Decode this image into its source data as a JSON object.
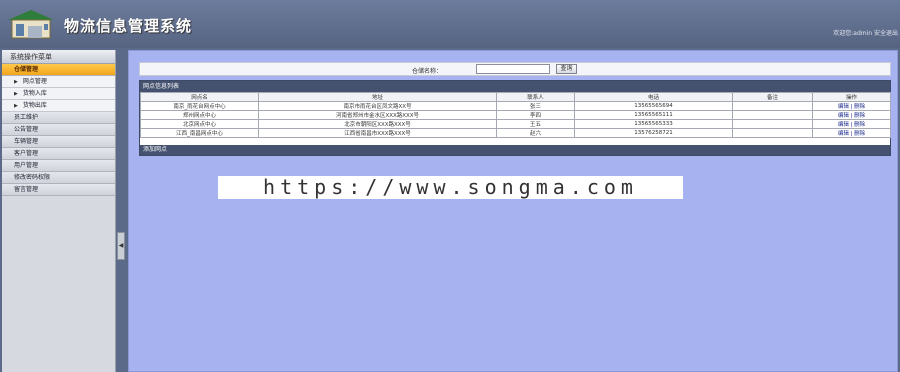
{
  "header": {
    "app_title": "物流信息管理系统",
    "user_info": "欢迎您:admin  安全退出"
  },
  "sidebar": {
    "title": "系统操作菜单",
    "items": [
      {
        "label": "仓储管理",
        "active": true
      },
      {
        "label": "网点管理",
        "sub": true
      },
      {
        "label": "货物入库",
        "sub": true
      },
      {
        "label": "货物出库",
        "sub": true
      },
      {
        "label": "员工维护"
      },
      {
        "label": "公告管理"
      },
      {
        "label": "车辆管理"
      },
      {
        "label": "客户管理"
      },
      {
        "label": "用户管理"
      },
      {
        "label": "修改密码权限"
      },
      {
        "label": "留言管理"
      }
    ]
  },
  "search": {
    "label": "仓储名称：",
    "value": "",
    "button": "查询"
  },
  "table": {
    "panel_title": "网点信息列表",
    "columns": [
      "网点名",
      "地址",
      "联系人",
      "电话",
      "备注",
      "操作"
    ],
    "rows": [
      [
        "南京_雨花台网点中心",
        "南京市雨花台区凤文路XX号",
        "张三",
        "13565565694",
        "",
        "编辑 | 删除"
      ],
      [
        "郑州网点中心",
        "河南省郑州市金水区XXX路XXX号",
        "李四",
        "13565565111",
        "",
        "编辑 | 删除"
      ],
      [
        "北京网点中心",
        "北京市朝阳区XXX路XXX号",
        "王五",
        "13565565333",
        "",
        "编辑 | 删除"
      ],
      [
        "江西_南昌网点中心",
        "江西省南昌市XXX路XXX号",
        "赵六",
        "13576258721",
        "",
        "编辑 | 删除"
      ]
    ],
    "add_label": "添加网点"
  },
  "watermark": "https://www.songma.com",
  "colors": {
    "header_bg": "#566482",
    "main_bg": "#a6b3f0",
    "active_item": "#f2a51c",
    "panel_head": "#44526f"
  }
}
